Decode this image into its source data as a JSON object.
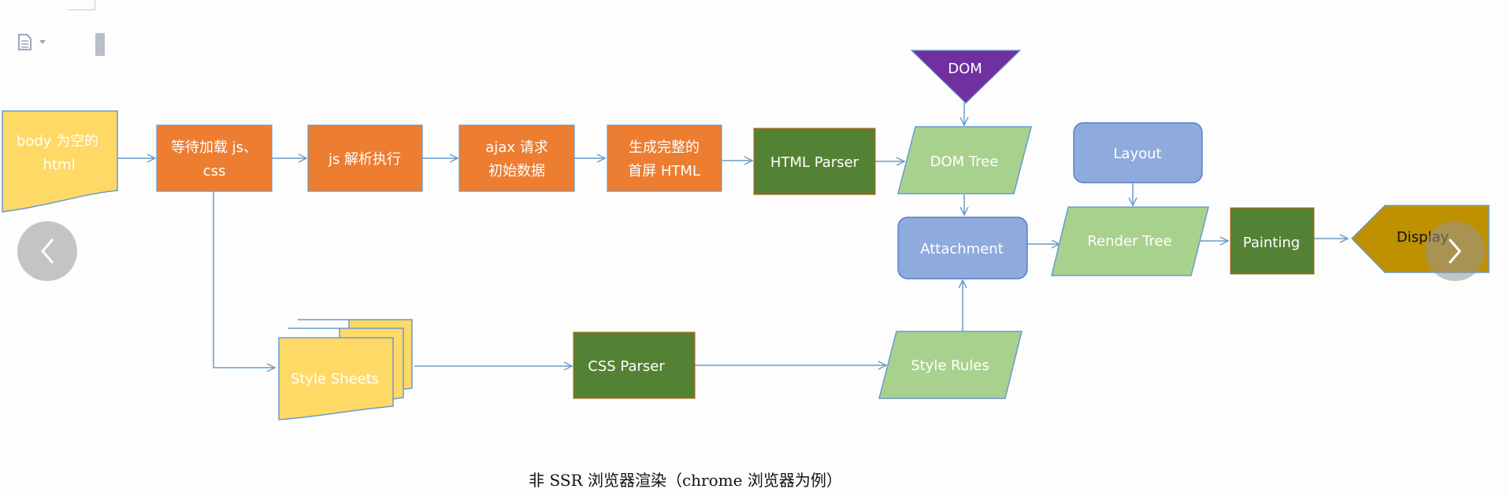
{
  "nodes": {
    "body_html": {
      "line1": "body 为空的",
      "line2": "html"
    },
    "wait_load": {
      "line1": "等待加载 js、",
      "line2": "css"
    },
    "js_exec": {
      "line1": "js 解析执行"
    },
    "ajax": {
      "line1": "ajax 请求",
      "line2": "初始数据"
    },
    "first_screen": {
      "line1": "生成完整的",
      "line2": "首屏 HTML"
    },
    "html_parser": {
      "line1": "HTML Parser"
    },
    "dom": {
      "line1": "DOM"
    },
    "dom_tree": {
      "line1": "DOM Tree"
    },
    "layout": {
      "line1": "Layout"
    },
    "attachment": {
      "line1": "Attachment"
    },
    "render_tree": {
      "line1": "Render Tree"
    },
    "painting": {
      "line1": "Painting"
    },
    "display": {
      "line1": "Display"
    },
    "style_sheets": {
      "line1": "Style Sheets"
    },
    "css_parser": {
      "line1": "CSS Parser"
    },
    "style_rules": {
      "line1": "Style Rules"
    }
  },
  "caption": "非 SSR 浏览器渲染（chrome 浏览器为例）",
  "icons": {
    "prev": "chevron-left-icon",
    "next": "chevron-right-icon",
    "doc": "document-icon"
  },
  "colors": {
    "orange": "#ED7D31",
    "dark_green": "#548235",
    "light_green": "#A9D18E",
    "blue": "#8FAADC",
    "yellow": "#FFD966",
    "purple": "#7030A0",
    "gold": "#BF9000",
    "connector": "#6A9BC8"
  }
}
